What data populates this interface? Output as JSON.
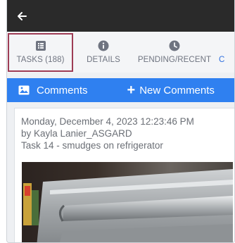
{
  "header": {
    "back_icon": "arrow-left-icon"
  },
  "tabs": [
    {
      "label": "TASKS (188)",
      "icon": "list-icon",
      "active": true
    },
    {
      "label": "DETAILS",
      "icon": "info-icon",
      "active": false
    },
    {
      "label": "PENDING/RECENT",
      "icon": "clock-icon",
      "active": false
    },
    {
      "label": "C",
      "icon": "",
      "active": false
    }
  ],
  "comments_bar": {
    "comments_label": "Comments",
    "comments_icon": "image-icon",
    "new_comments_label": "New Comments",
    "new_icon": "plus-icon"
  },
  "comment": {
    "timestamp": "Monday, December 4, 2023 12:23:46 PM",
    "author": "by Kayla Lanier_ASGARD",
    "task": "Task 14 - smudges on refrigerator",
    "photo": "refrigerator-door-photo"
  },
  "colors": {
    "topbar": "#2a2a2a",
    "accent_blue": "#2f80f0",
    "highlight": "#9e3c55",
    "tab_text": "#6f7480"
  }
}
